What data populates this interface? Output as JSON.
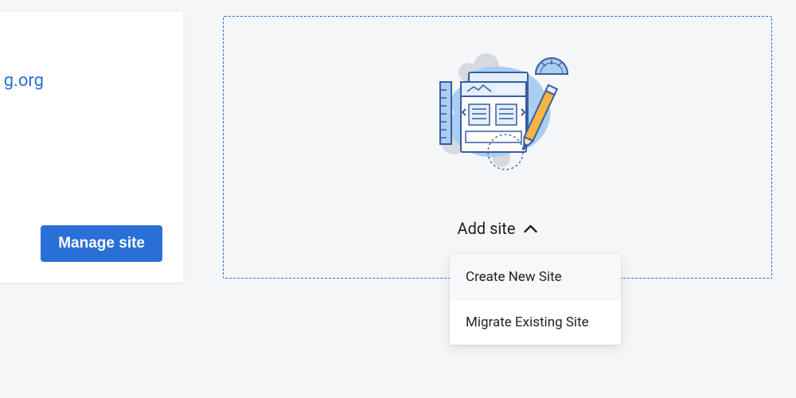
{
  "site_card": {
    "domain_suffix": "g.org",
    "manage_label": "Manage site"
  },
  "add_card": {
    "toggle_label": "Add site",
    "menu": {
      "create_label": "Create New Site",
      "migrate_label": "Migrate Existing Site"
    }
  },
  "colors": {
    "accent": "#2a6fd6"
  }
}
